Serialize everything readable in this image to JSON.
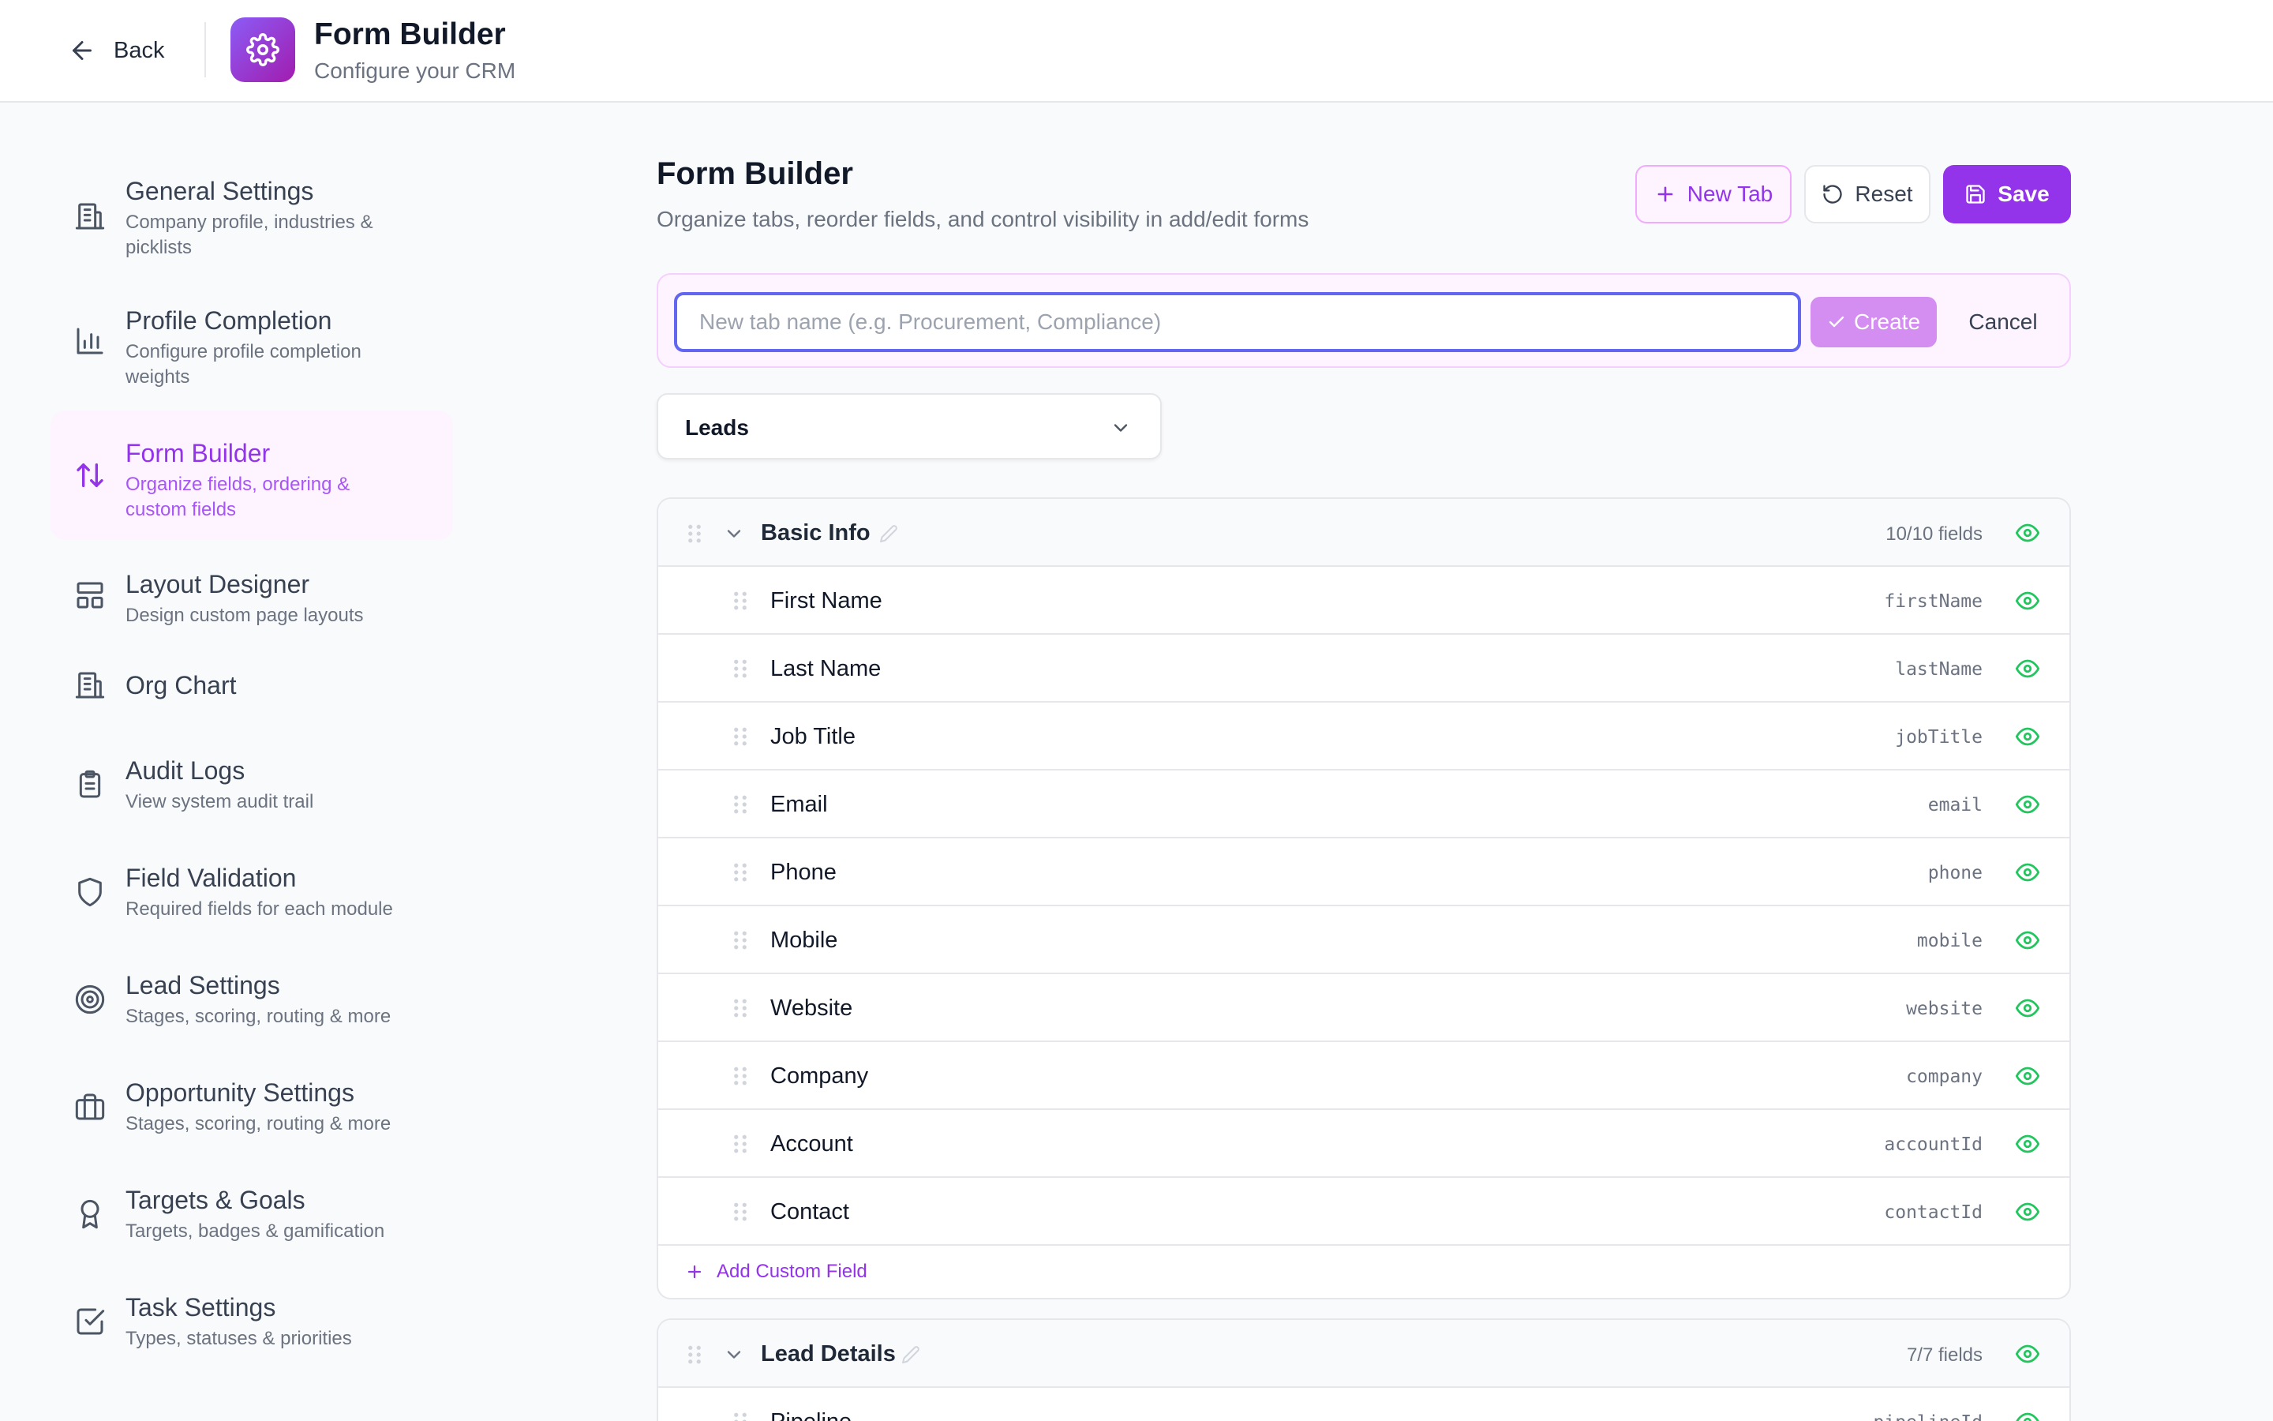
{
  "header": {
    "back_label": "Back",
    "title": "Form Builder",
    "subtitle": "Configure your CRM"
  },
  "sidebar": {
    "items": [
      {
        "icon": "building-icon",
        "title": "General Settings",
        "desc": "Company profile, industries & picklists"
      },
      {
        "icon": "bar-chart-icon",
        "title": "Profile Completion",
        "desc": "Configure profile completion weights"
      },
      {
        "icon": "sort-arrows-icon",
        "title": "Form Builder",
        "desc": "Organize fields, ordering & custom fields",
        "active": true
      },
      {
        "icon": "layout-icon",
        "title": "Layout Designer",
        "desc": "Design custom page layouts"
      },
      {
        "icon": "org-chart-icon",
        "title": "Org Chart",
        "desc": ""
      },
      {
        "icon": "clipboard-icon",
        "title": "Audit Logs",
        "desc": "View system audit trail"
      },
      {
        "icon": "shield-icon",
        "title": "Field Validation",
        "desc": "Required fields for each module"
      },
      {
        "icon": "target-icon",
        "title": "Lead Settings",
        "desc": "Stages, scoring, routing & more"
      },
      {
        "icon": "briefcase-icon",
        "title": "Opportunity Settings",
        "desc": "Stages, scoring, routing & more"
      },
      {
        "icon": "award-icon",
        "title": "Targets & Goals",
        "desc": "Targets, badges & gamification"
      },
      {
        "icon": "check-square-icon",
        "title": "Task Settings",
        "desc": "Types, statuses & priorities"
      }
    ]
  },
  "main": {
    "title": "Form Builder",
    "subtitle": "Organize tabs, reorder fields, and control visibility in add/edit forms",
    "new_tab_label": "New Tab",
    "reset_label": "Reset",
    "save_label": "Save",
    "new_tab_form": {
      "placeholder": "New tab name (e.g. Procurement, Compliance)",
      "value": "",
      "create_label": "Create",
      "cancel_label": "Cancel"
    },
    "module_select": {
      "value": "Leads"
    },
    "sections": [
      {
        "title": "Basic Info",
        "count": "10/10 fields",
        "fields": [
          {
            "label": "First Name",
            "key": "firstName"
          },
          {
            "label": "Last Name",
            "key": "lastName"
          },
          {
            "label": "Job Title",
            "key": "jobTitle"
          },
          {
            "label": "Email",
            "key": "email"
          },
          {
            "label": "Phone",
            "key": "phone"
          },
          {
            "label": "Mobile",
            "key": "mobile"
          },
          {
            "label": "Website",
            "key": "website"
          },
          {
            "label": "Company",
            "key": "company"
          },
          {
            "label": "Account",
            "key": "accountId"
          },
          {
            "label": "Contact",
            "key": "contactId"
          }
        ],
        "add_label": "Add Custom Field"
      },
      {
        "title": "Lead Details",
        "count": "7/7 fields",
        "fields": [
          {
            "label": "Pipeline",
            "key": "pipelineId"
          }
        ]
      }
    ]
  },
  "colors": {
    "accent": "#9333ea",
    "accent_soft": "#fdf4ff",
    "visible_eye": "#22c55e",
    "focus_ring": "#6366f1"
  }
}
